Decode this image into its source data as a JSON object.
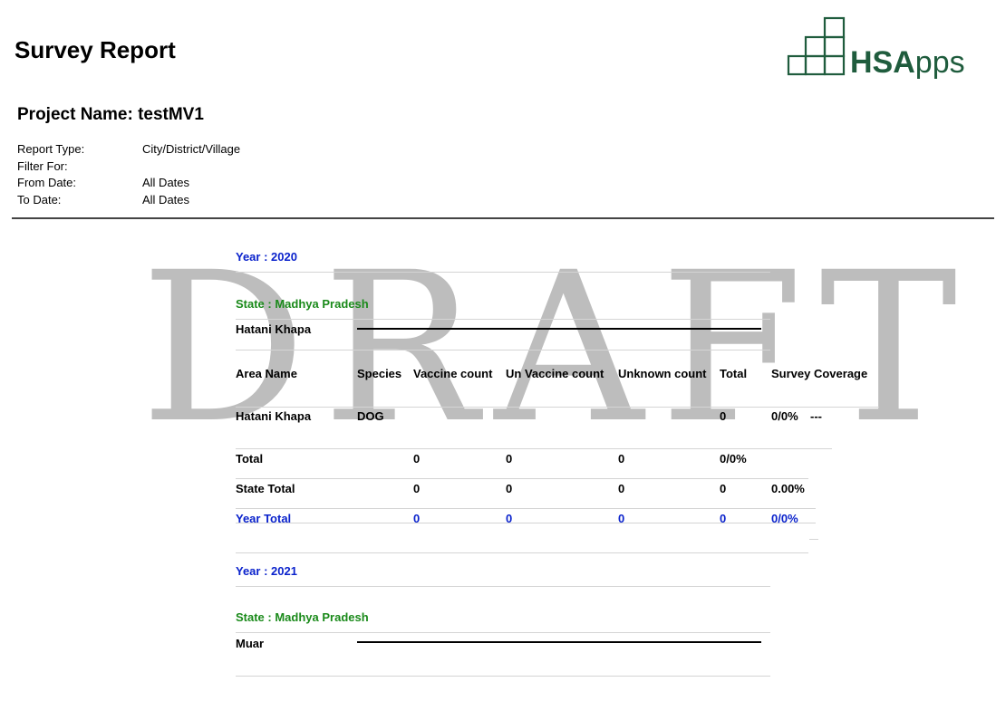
{
  "report": {
    "title": "Survey Report",
    "project_label": "Project Name:",
    "project_name": "testMV1",
    "meta": [
      {
        "label": "Report Type:",
        "value": "City/District/Village"
      },
      {
        "label": "Filter For:",
        "value": ""
      },
      {
        "label": "From Date:",
        "value": "All Dates"
      },
      {
        "label": "To Date:",
        "value": "All Dates"
      }
    ]
  },
  "logo": {
    "text_strong": "HSA",
    "text_rest": "pps",
    "color": "#1f5c3d"
  },
  "watermark": "DRAFT",
  "table": {
    "year1": {
      "label": "Year : 2020",
      "state": "State : Madhya Pradesh",
      "district": "Hatani Khapa",
      "headers": [
        "Area Name",
        "Species",
        "Vaccine count",
        "Un Vaccine count",
        "Unknown count",
        "Total",
        "Survey Coverage"
      ],
      "row": {
        "area": "Hatani Khapa",
        "species": "DOG",
        "total": "0",
        "coverage": "0/0%",
        "extra": "---"
      },
      "total": {
        "label": "Total",
        "vaccine": "0",
        "unvaccine": "0",
        "unknown": "0",
        "total": "0/0%"
      },
      "state_total": {
        "label": "State Total",
        "vaccine": "0",
        "unvaccine": "0",
        "unknown": "0",
        "total": "0",
        "coverage": "0.00%"
      },
      "year_total": {
        "label": "Year Total",
        "vaccine": "0",
        "unvaccine": "0",
        "unknown": "0",
        "total": "0",
        "coverage": "0/0%"
      }
    },
    "year2": {
      "label": "Year : 2021",
      "state": "State : Madhya Pradesh",
      "district": "Muar"
    }
  },
  "colors": {
    "year": "#0a22cc",
    "state": "#1a8a1a",
    "logo": "#1f5c3d"
  }
}
